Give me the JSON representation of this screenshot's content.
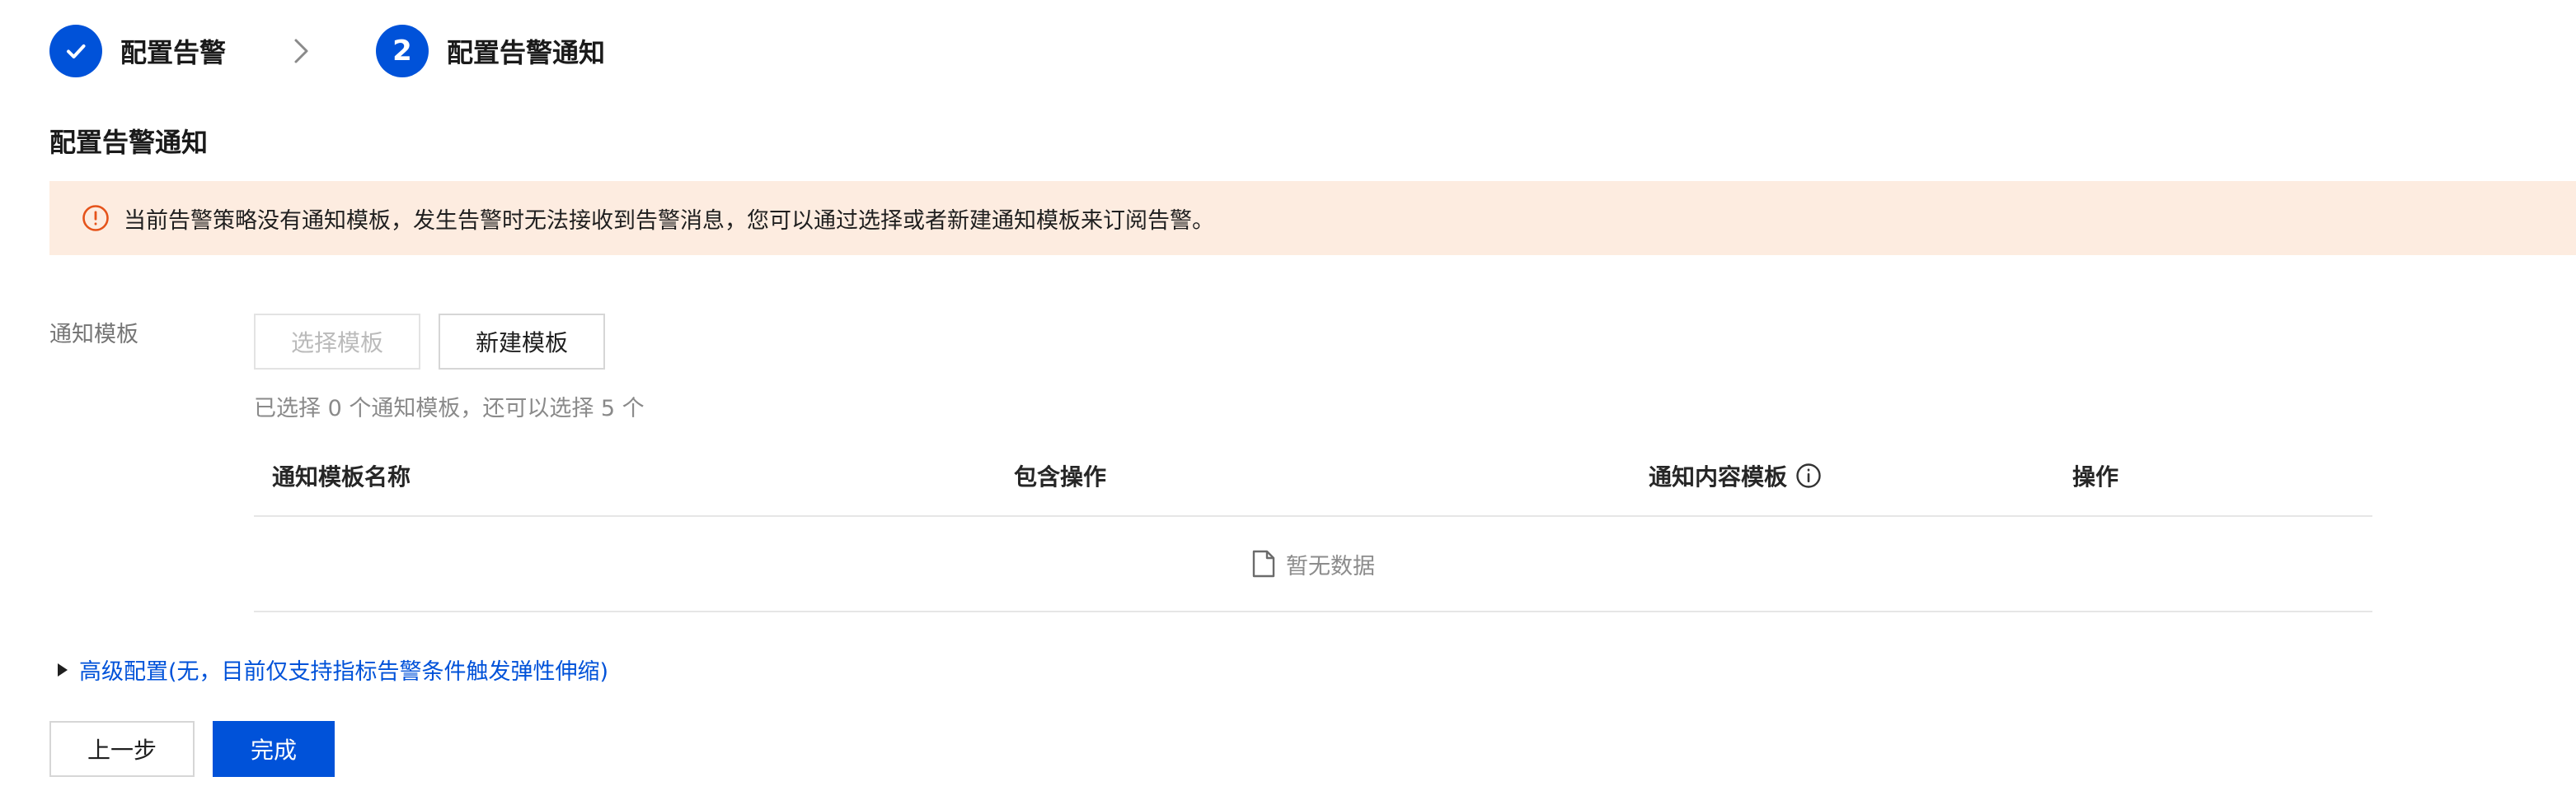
{
  "steps": [
    {
      "index": "✓",
      "label": "配置告警",
      "state": "done"
    },
    {
      "index": "2",
      "label": "配置告警通知",
      "state": "current"
    }
  ],
  "section": {
    "title": "配置告警通知"
  },
  "alert": {
    "message": "当前告警策略没有通知模板，发生告警时无法接收到告警消息，您可以通过选择或者新建通知模板来订阅告警。",
    "color": "#fdece0",
    "icon": "warning-circle-icon"
  },
  "form": {
    "label": "通知模板",
    "select_button": "选择模板",
    "new_button": "新建模板",
    "hint": "已选择 0 个通知模板，还可以选择 5 个"
  },
  "table": {
    "columns": [
      "通知模板名称",
      "包含操作",
      "通知内容模板",
      "操作"
    ],
    "empty_text": "暂无数据"
  },
  "advanced": {
    "label": "高级配置(无，目前仅支持指标告警条件触发弹性伸缩)"
  },
  "footer": {
    "prev_button": "上一步",
    "done_button": "完成"
  },
  "colors": {
    "primary": "#0052d9",
    "warning": "#e5531a"
  }
}
